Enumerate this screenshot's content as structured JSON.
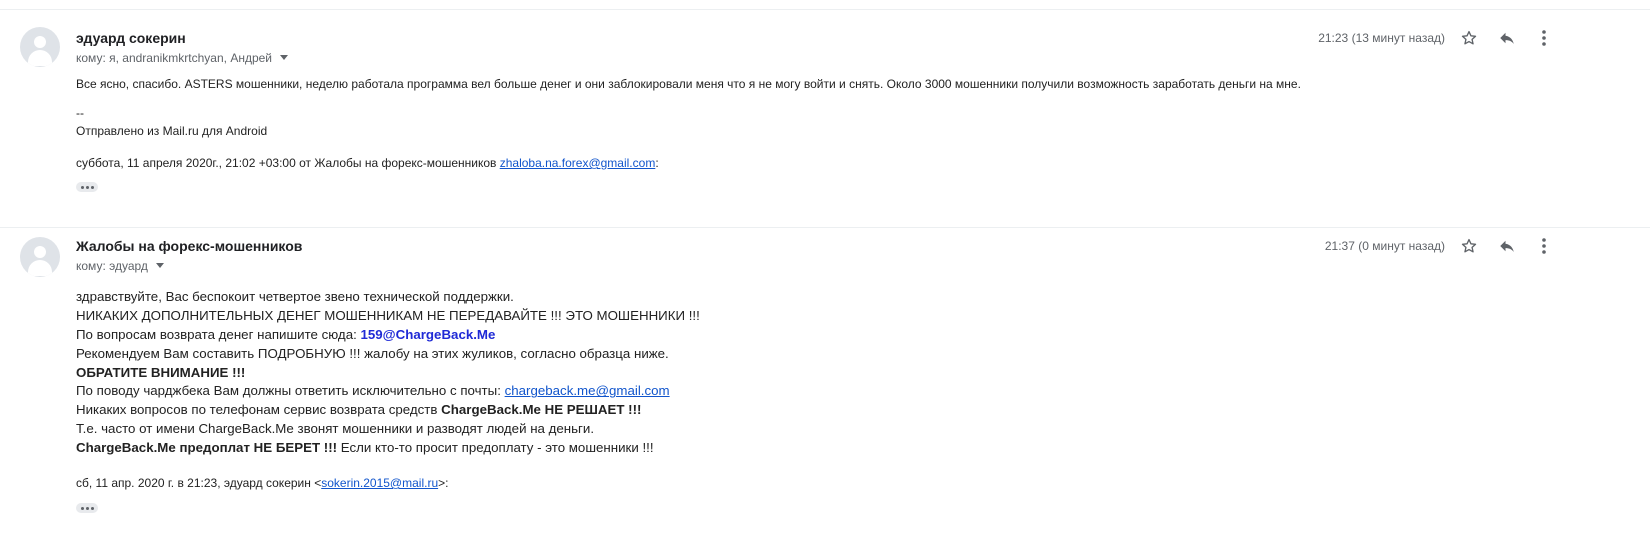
{
  "messages": [
    {
      "sender": "эдуард сокерин",
      "recipients": "кому: я, andranikmkrtchyan, Андрей",
      "time": "21:23 (13 минут назад)",
      "body": "Все ясно, спасибо. ASTERS  мошенники, неделю работала программа вел больше денег и они заблокировали  меня что я не могу войти и снять. Около 3000 мошенники получили возможность заработать деньги на мне.",
      "signature_sep": "--",
      "signature": "Отправлено из Mail.ru для Android",
      "quote_header_prefix": "суббота, 11 апреля 2020г., 21:02 +03:00 от Жалобы на форекс-мошенников ",
      "quote_header_email": "zhaloba.na.forex@gmail.com",
      "quote_header_suffix": ":"
    },
    {
      "sender": "Жалобы на форекс-мошенников",
      "recipients": "кому: эдуард",
      "time": "21:37 (0 минут назад)",
      "lines": {
        "l1": "здравствуйте, Вас беспокоит четвертое звено технической поддержки.",
        "l2": "НИКАКИХ ДОПОЛНИТЕЛЬНЫХ ДЕНЕГ МОШЕННИКАМ НЕ ПЕРЕДАВАЙТЕ !!! ЭТО МОШЕННИКИ !!!",
        "l3_prefix": "По вопросам возврата денег напишите сюда: ",
        "l3_email": "159@ChargeBack.Me",
        "l4": "Рекомендуем Вам составить ПОДРОБНУЮ !!! жалобу на этих жуликов, согласно образца ниже.",
        "l5": "ОБРАТИТЕ ВНИМАНИЕ !!!",
        "l6_prefix": "По поводу чарджбека Вам должны ответить исключительно с почты: ",
        "l6_email": "chargeback.me@gmail.com",
        "l7_prefix": "Никаких вопросов по телефонам сервис возврата средств ",
        "l7_bold": "ChargeBack.Me НЕ РЕШАЕТ !!!",
        "l8": "Т.е. часто от имени ChargeBack.Me звонят мошенники и разводят людей на деньги.",
        "l9_bold": "ChargeBack.Me предоплат НЕ БЕРЕТ !!!",
        "l9_suffix": " Если кто-то просит предоплату - это мошенники !!!"
      },
      "quote_header_prefix": "сб, 11 апр. 2020 г. в 21:23, эдуард сокерин <",
      "quote_header_email": "sokerin.2015@mail.ru",
      "quote_header_suffix": ">:"
    }
  ],
  "icons": {
    "avatar": "person-avatar",
    "star": "star-outline-icon",
    "reply": "reply-icon",
    "more": "more-vert-icon",
    "expand": "more-horiz-icon"
  },
  "colors": {
    "link": "#1155cc",
    "highlight_email": "#1f2ad6",
    "muted": "#5f6368"
  }
}
